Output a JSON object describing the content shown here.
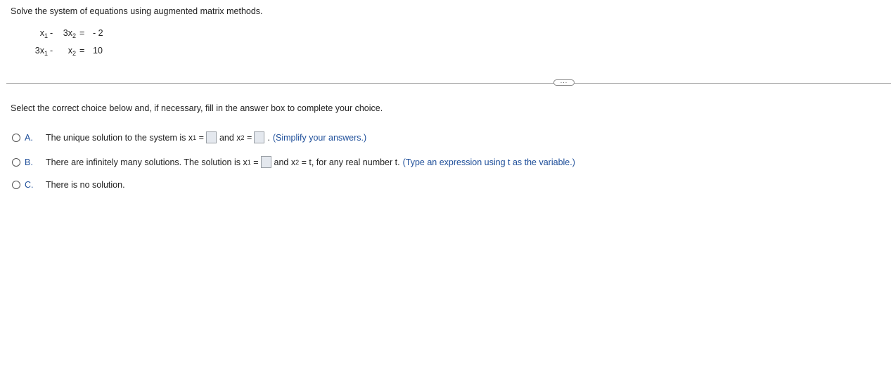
{
  "question": {
    "prompt": "Solve the system of equations using augmented matrix methods.",
    "equations": [
      {
        "c1": "x",
        "c1_sub": "1",
        "c1_coef": "",
        "op": "-",
        "c2_coef": "3x",
        "c2_sub": "2",
        "eq": "=",
        "rhs": "- 2"
      },
      {
        "c1": "x",
        "c1_sub": "1",
        "c1_coef": "3",
        "op": "-",
        "c2_coef": "x",
        "c2_sub": "2",
        "eq": "=",
        "rhs": "10"
      }
    ]
  },
  "more_button": "...",
  "instruction": "Select the correct choice below and, if necessary, fill in the answer box to complete your choice.",
  "choices": {
    "a": {
      "letter": "A.",
      "text1": "The unique solution to the system is x",
      "sub1": "1",
      "eq1": " =",
      "text2": "and x",
      "sub2": "2",
      "eq2": " =",
      "text3": ".",
      "hint": "(Simplify your answers.)"
    },
    "b": {
      "letter": "B.",
      "text1": "There are infinitely many solutions. The solution is x",
      "sub1": "1",
      "eq1": " =",
      "text2": "and x",
      "sub2": "2",
      "text3": " = t, for any real number t.",
      "hint": "(Type an expression using t as the variable.)"
    },
    "c": {
      "letter": "C.",
      "text": "There is no solution."
    }
  }
}
